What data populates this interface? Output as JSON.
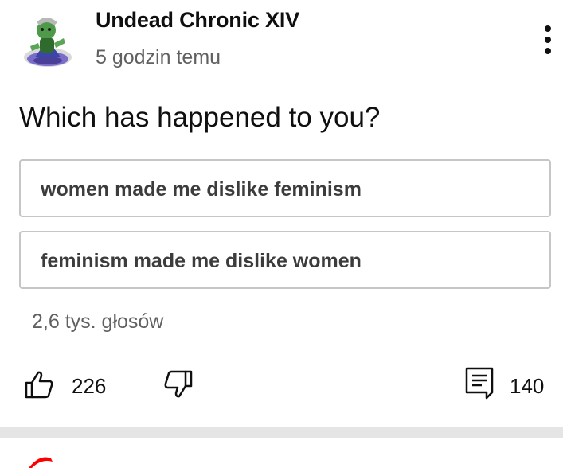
{
  "post": {
    "author": "Undead Chronic XIV",
    "time": "5 godzin temu",
    "question": "Which has happened to you?",
    "options": [
      "women made me dislike feminism",
      "feminism made me dislike women"
    ],
    "votes": "2,6 tys. głosów",
    "likes": "226",
    "comments": "140"
  },
  "colors": {
    "accent_red": "#ff0000",
    "text_primary": "#0f0f0f",
    "text_secondary": "#606060",
    "option_border": "#c6c6c6",
    "divider": "#e5e5e5"
  },
  "icons": {
    "avatar": "avatar-image",
    "menu": "more-vert-icon",
    "like": "thumb-up-icon",
    "dislike": "thumb-down-icon",
    "comment": "comment-icon"
  }
}
